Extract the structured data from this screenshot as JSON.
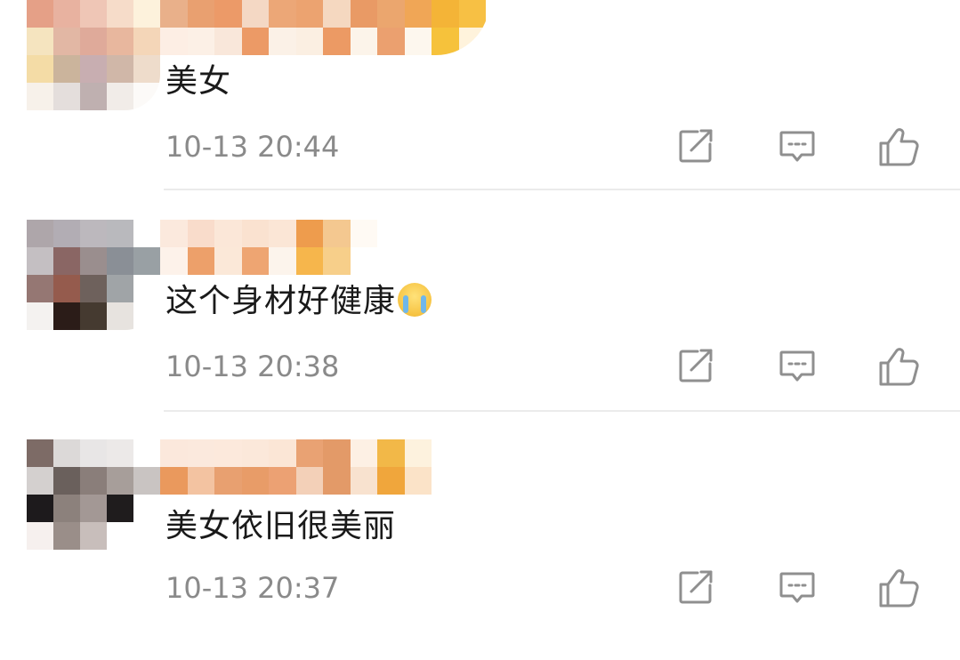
{
  "comments": [
    {
      "text": "美女",
      "time": "10-13 20:44",
      "avatar_colors": [
        "#e5a087",
        "#e8b2a0",
        "#efc6b6",
        "#f6dcc9",
        "#fdf2dc",
        "#f5e4bf",
        "#e2b7a4",
        "#dfaa9a",
        "#e8b79e",
        "#f4d6b8",
        "#f4dca6",
        "#cbb49c",
        "#c8aeb1",
        "#d0b7a8",
        "#eedccb",
        "#f7f1ea",
        "#e4dedc",
        "#bfb0b0",
        "#f1ece8",
        "#fcfaf8"
      ],
      "name_colors": [
        "#e9b08a",
        "#e9a070",
        "#ec9a68",
        "#f4d8c4",
        "#eca777",
        "#eca370",
        "#f5d8c0",
        "#e99a65",
        "#eba66e",
        "#f0a656",
        "#f4b437",
        "#f7c044",
        "#fdeee4",
        "#fcf0e6",
        "#f9e7da",
        "#ec9a66",
        "#fbf1e7",
        "#fbefe2",
        "#ec9a64",
        "#fcf4ea",
        "#eba06f",
        "#fdf7ee",
        "#f6c23b",
        "#fff3dc"
      ]
    },
    {
      "text": "这个身材好健康",
      "emoji": "crying-face",
      "time": "10-13 20:38",
      "avatar_colors": [
        "#aea6aa",
        "#b2adb4",
        "#bcb8bd",
        "#b9b9bd",
        "#ffffff",
        "#c4bfc2",
        "#8a6664",
        "#9a8e8e",
        "#8a8f96",
        "#99a0a4",
        "#957773",
        "#955b4d",
        "#6e615c",
        "#a0a4a7",
        "#ffffff",
        "#f4f2f0",
        "#2b1c18",
        "#453a30",
        "#e7e3df",
        "#ffffff"
      ],
      "name_colors": [
        "#fbe9dd",
        "#f9dccb",
        "#fbe7d8",
        "#fae2d0",
        "#fbe6d6",
        "#ee9c4d",
        "#f4c890",
        "#fffaf4",
        "#ffffff",
        "#ffffff",
        "#ffffff",
        "#ffffff",
        "#fdf2ea",
        "#eda06a",
        "#fbe8d8",
        "#eea572",
        "#fcf4ec",
        "#f6b64c",
        "#f7cf8a",
        "#ffffff",
        "#ffffff",
        "#ffffff",
        "#ffffff",
        "#ffffff"
      ]
    },
    {
      "text": "美女依旧很美丽",
      "time": "10-13 20:37",
      "avatar_colors": [
        "#7d6b66",
        "#dcd9d8",
        "#e8e6e6",
        "#ece9e8",
        "#ffffff",
        "#d4d0cf",
        "#6a605c",
        "#8a7e7a",
        "#a79e9a",
        "#c9c4c2",
        "#1d1a1c",
        "#8c817c",
        "#a39895",
        "#1f1c1d",
        "#ffffff",
        "#f6f0ee",
        "#9a8e89",
        "#c8bebb",
        "#ffffff",
        "#ffffff"
      ],
      "name_colors": [
        "#fbe8dc",
        "#fbe9dd",
        "#fce9dc",
        "#fbe8da",
        "#fbe6d6",
        "#e9a273",
        "#e39a68",
        "#fdf0e4",
        "#f2b848",
        "#fdf2de",
        "#ffffff",
        "#ffffff",
        "#ea995d",
        "#f3c3a1",
        "#e8a070",
        "#e89c68",
        "#eca173",
        "#f3d0b8",
        "#e39a68",
        "#f8e2cf",
        "#f0a63c",
        "#fbe3c8",
        "#ffffff",
        "#ffffff"
      ]
    }
  ],
  "colors": {
    "text": "#1a1a1a",
    "time": "#8a8a8a",
    "icon": "#8f8f8f",
    "divider": "#ebebeb"
  },
  "icons": [
    "share-icon",
    "comment-icon",
    "like-icon"
  ]
}
